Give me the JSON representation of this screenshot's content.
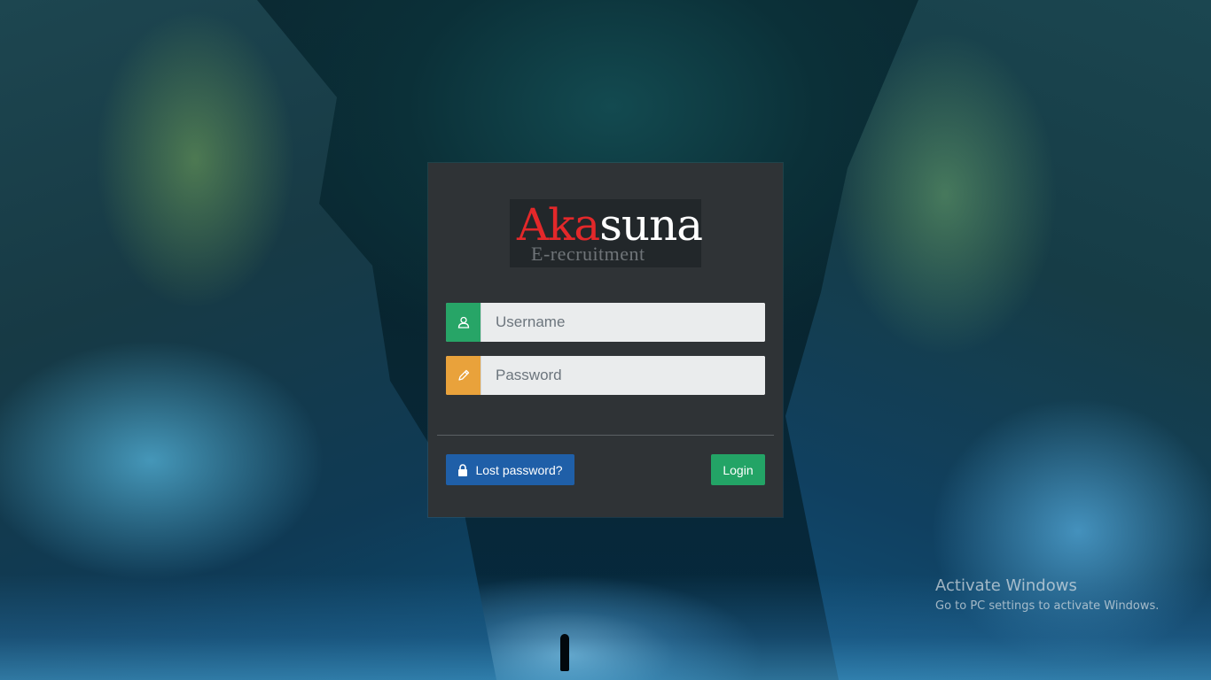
{
  "branding": {
    "logo_part_red": "Aka",
    "logo_part_white": "suna",
    "logo_subtitle": "E-recruitment"
  },
  "form": {
    "username_placeholder": "Username",
    "password_placeholder": "Password",
    "username_value": "",
    "password_value": ""
  },
  "actions": {
    "lost_password_label": "Lost password?",
    "login_label": "Login"
  },
  "watermark": {
    "title": "Activate Windows",
    "subtitle": "Go to PC settings to activate Windows."
  },
  "colors": {
    "panel": "#2f3336",
    "user_addon": "#27a567",
    "pass_addon": "#e9a23b",
    "lost_button": "#1f5fa8",
    "login_button": "#23a466",
    "logo_red": "#e3282a"
  },
  "icons": {
    "username": "user-icon",
    "password": "pencil-icon",
    "lost_password": "lock-icon"
  }
}
